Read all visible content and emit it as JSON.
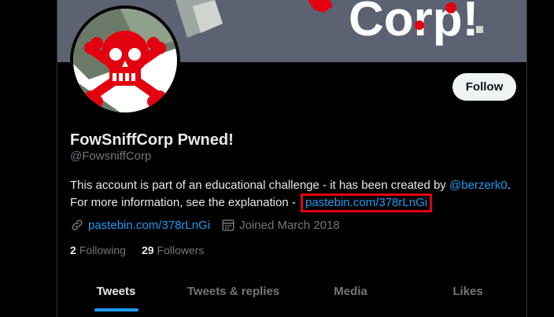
{
  "profile": {
    "display_name": "FowSniffCorp Pwned!",
    "handle": "@FowsniffCorp",
    "follow_label": "Follow",
    "banner_text": "Corp!"
  },
  "bio": {
    "line1_text": "This account is part of an educational challenge - it has been created by ",
    "line1_mention": "@berzerk0",
    "line1_end": ".",
    "line2_text": "For more information, see the explanation - ",
    "line2_link": "pastebin.com/378rLnGi"
  },
  "meta": {
    "website": "pastebin.com/378rLnGi",
    "joined": "Joined March 2018"
  },
  "stats": {
    "following_count": "2",
    "following_label": "Following",
    "followers_count": "29",
    "followers_label": "Followers"
  },
  "tabs": [
    {
      "label": "Tweets",
      "active": true
    },
    {
      "label": "Tweets & replies",
      "active": false
    },
    {
      "label": "Media",
      "active": false
    },
    {
      "label": "Likes",
      "active": false
    }
  ],
  "colors": {
    "accent": "#1d9bf0",
    "highlight_box": "#e3000f",
    "skull_red": "#e3000f",
    "banner_bg": "#5d6272"
  },
  "icons": {
    "link": "link-icon",
    "calendar": "calendar-icon"
  }
}
